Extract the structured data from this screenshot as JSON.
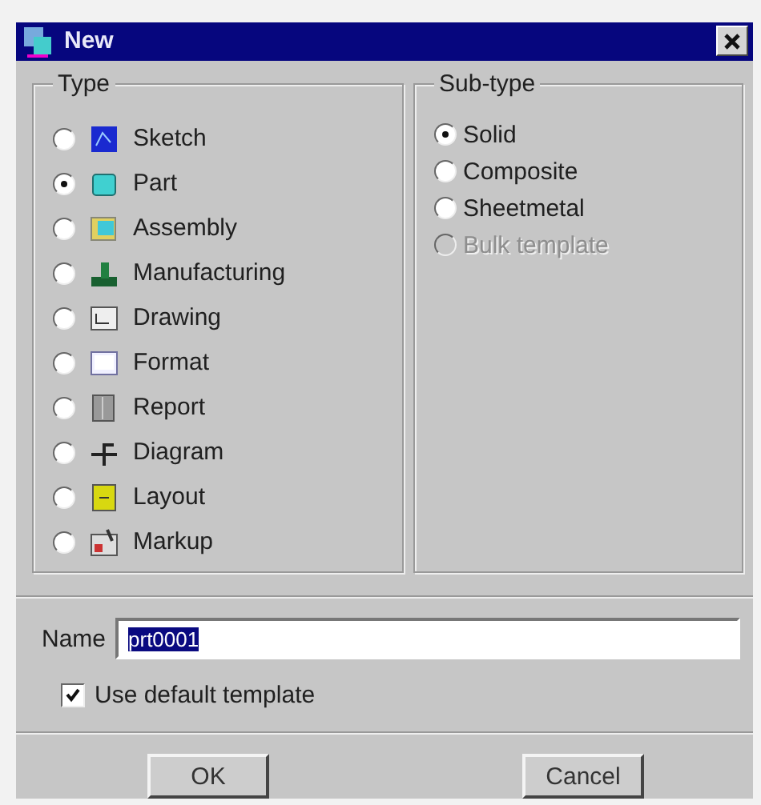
{
  "window": {
    "title": "New"
  },
  "type_group": {
    "title": "Type",
    "options": [
      {
        "label": "Sketch",
        "selected": false
      },
      {
        "label": "Part",
        "selected": true
      },
      {
        "label": "Assembly",
        "selected": false
      },
      {
        "label": "Manufacturing",
        "selected": false
      },
      {
        "label": "Drawing",
        "selected": false
      },
      {
        "label": "Format",
        "selected": false
      },
      {
        "label": "Report",
        "selected": false
      },
      {
        "label": "Diagram",
        "selected": false
      },
      {
        "label": "Layout",
        "selected": false
      },
      {
        "label": "Markup",
        "selected": false
      }
    ]
  },
  "subtype_group": {
    "title": "Sub-type",
    "options": [
      {
        "label": "Solid",
        "selected": true,
        "disabled": false
      },
      {
        "label": "Composite",
        "selected": false,
        "disabled": false
      },
      {
        "label": "Sheetmetal",
        "selected": false,
        "disabled": false
      },
      {
        "label": "Bulk template",
        "selected": false,
        "disabled": true
      }
    ]
  },
  "name_field": {
    "label": "Name",
    "value": "prt0001"
  },
  "use_default_template": {
    "label": "Use default template",
    "checked": true
  },
  "buttons": [
    "OK",
    "Cancel"
  ]
}
